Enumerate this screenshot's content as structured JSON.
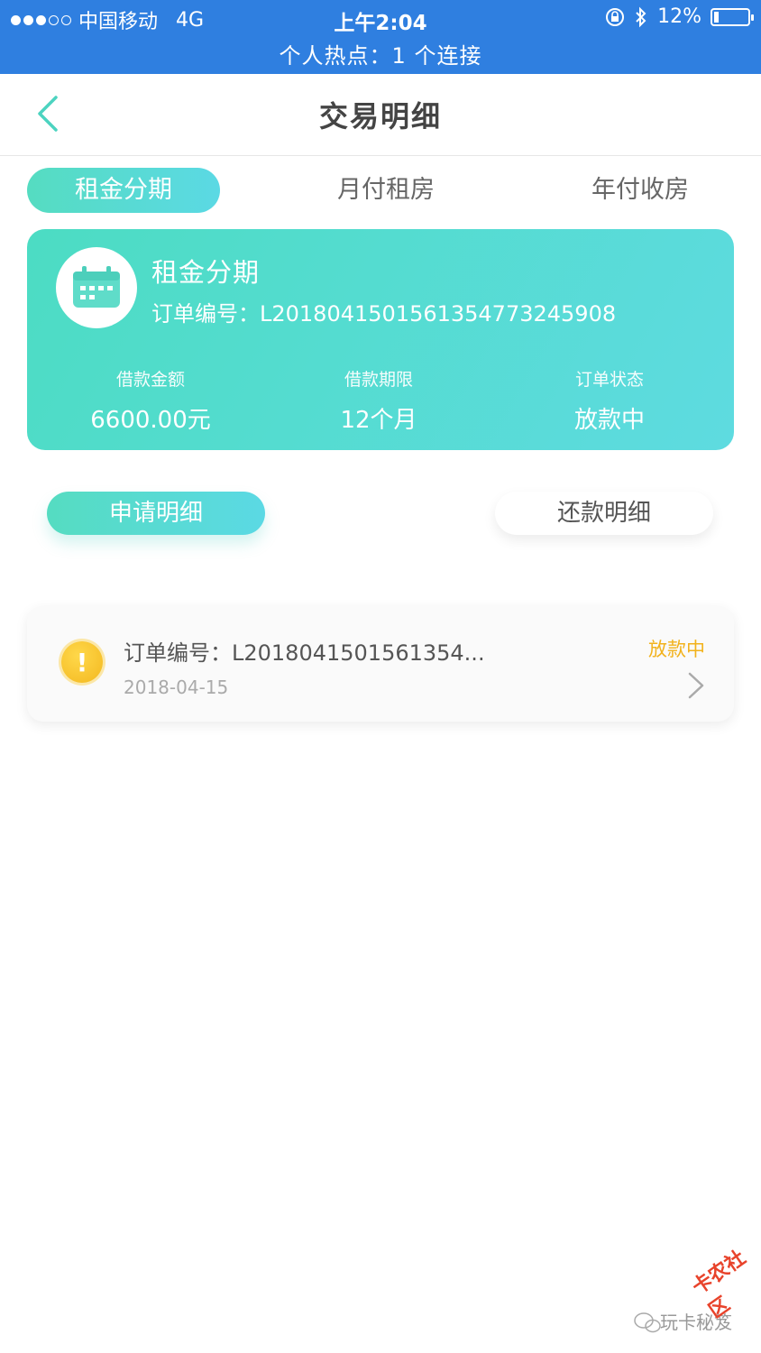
{
  "status_bar": {
    "carrier": "中国移动",
    "network": "4G",
    "time": "上午2:04",
    "battery": "12%",
    "hotspot": "个人热点：1 个连接"
  },
  "nav": {
    "title": "交易明细"
  },
  "tabs": [
    {
      "label": "租金分期"
    },
    {
      "label": "月付租房"
    },
    {
      "label": "年付收房"
    }
  ],
  "card": {
    "title": "租金分期",
    "order_label": "订单编号：",
    "order_number": "L201804150156135477324590​8",
    "stats": [
      {
        "label": "借款金额",
        "value": "6600.00元"
      },
      {
        "label": "借款期限",
        "value": "12个月"
      },
      {
        "label": "订单状态",
        "value": "放款中"
      }
    ]
  },
  "sub_tabs": {
    "apply": "申请明细",
    "repay": "还款明细"
  },
  "records": [
    {
      "order": "订单编号：L2018041501561354...",
      "date": "2018-04-15",
      "status": "放款中"
    }
  ],
  "watermark": {
    "text": "玩卡秘笈",
    "stamp": "卡农社区"
  },
  "colors": {
    "status_bar": "#2f7fe0",
    "accent": "#55dcc1",
    "warning": "#f2b21c"
  }
}
